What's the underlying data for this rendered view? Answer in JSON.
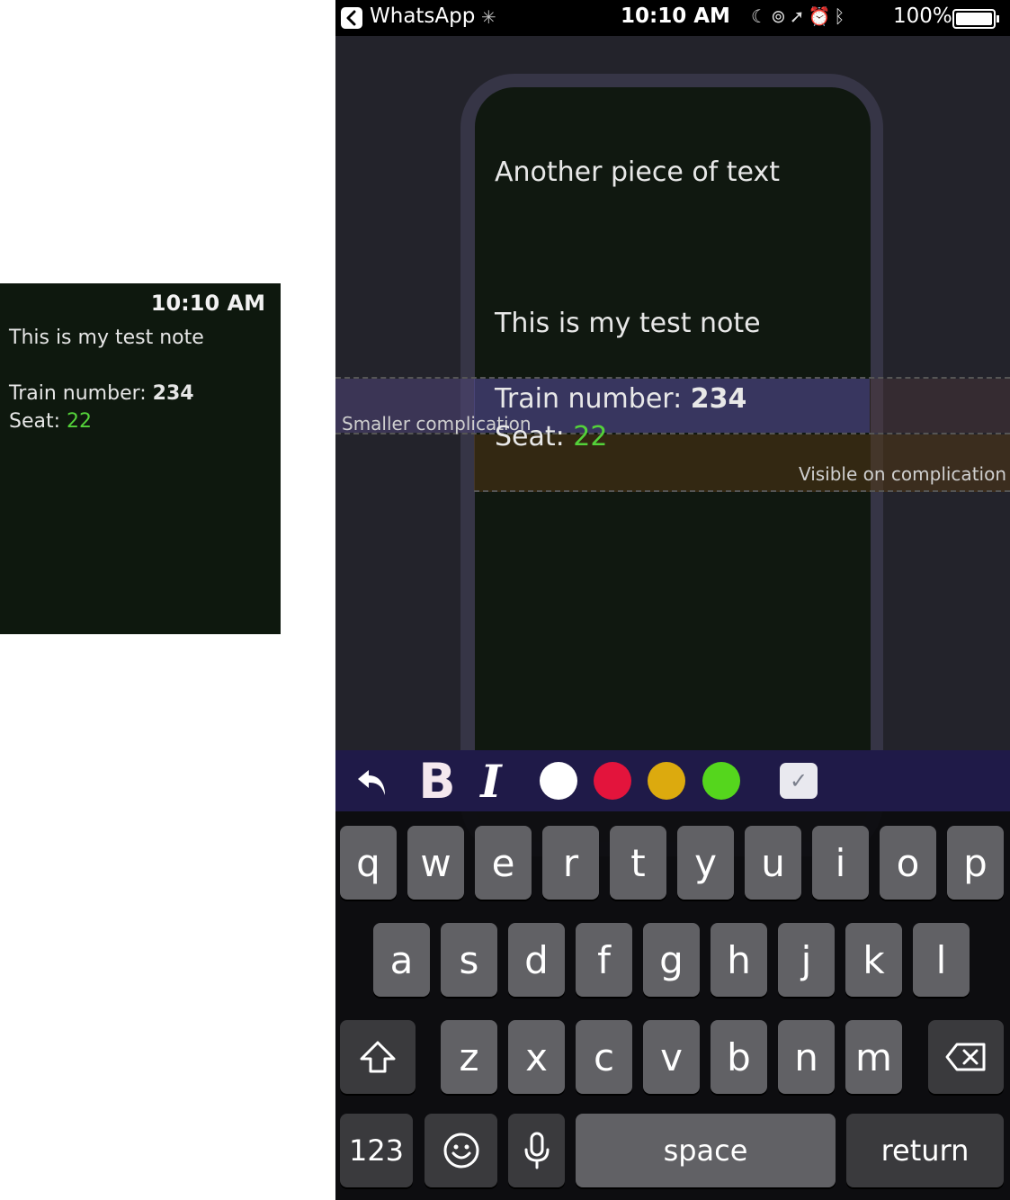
{
  "watch_preview": {
    "time": "10:10 AM",
    "lines": [
      "This is my test note"
    ],
    "train_label": "Train number: ",
    "train_value": "234",
    "seat_label": "Seat: ",
    "seat_value": "22"
  },
  "status_bar": {
    "back_app": "WhatsApp",
    "time": "10:10 AM",
    "battery": "100%",
    "icons": [
      "moon-icon",
      "rotation-lock-icon",
      "location-icon",
      "alarm-icon",
      "bluetooth-icon"
    ]
  },
  "note": {
    "line1": "Another piece of text",
    "line2": "This is my test note",
    "train_label": "Train number: ",
    "train_value": "234",
    "seat_label": "Seat: ",
    "seat_value": "22"
  },
  "complications": {
    "smaller_label": "Smaller complication",
    "visible_label": "Visible on complication"
  },
  "toolbar": {
    "bold": "B",
    "italic": "I",
    "colors": [
      "#ffffff",
      "#e3143c",
      "#dcaa0e",
      "#55d61d"
    ]
  },
  "keyboard": {
    "row1": [
      "q",
      "w",
      "e",
      "r",
      "t",
      "y",
      "u",
      "i",
      "o",
      "p"
    ],
    "row2": [
      "a",
      "s",
      "d",
      "f",
      "g",
      "h",
      "j",
      "k",
      "l"
    ],
    "row3": [
      "z",
      "x",
      "c",
      "v",
      "b",
      "n",
      "m"
    ],
    "numbers": "123",
    "space": "space",
    "return": "return"
  }
}
